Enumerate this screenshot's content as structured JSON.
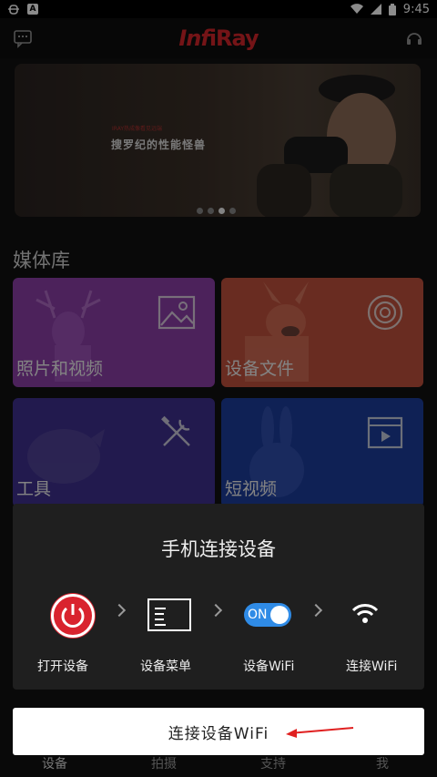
{
  "status_bar": {
    "time": "9:45"
  },
  "header": {
    "logo_prefix": "Inf",
    "logo_suffix": "iRay"
  },
  "banner": {
    "tagline": "IRAY热成像看见远端",
    "title": "搜罗纪的性能怪兽",
    "slide_count": 4,
    "active_slide": 3
  },
  "media_library": {
    "title": "媒体库",
    "tiles": [
      {
        "label": "照片和视频",
        "icon": "image-icon",
        "color": "#8a3ea7"
      },
      {
        "label": "设备文件",
        "icon": "target-icon",
        "color": "#c0503d"
      },
      {
        "label": "工具",
        "icon": "tools-icon",
        "color": "#3f318f"
      },
      {
        "label": "短视频",
        "icon": "video-icon",
        "color": "#1d3c9b"
      }
    ]
  },
  "dialog": {
    "title": "手机连接设备",
    "steps": [
      {
        "label": "打开设备",
        "icon": "power-icon"
      },
      {
        "label": "设备菜单",
        "icon": "menu-icon"
      },
      {
        "label": "设备WiFi",
        "icon": "toggle-icon",
        "toggle_text": "ON"
      },
      {
        "label": "连接WiFi",
        "icon": "wifi-icon"
      }
    ]
  },
  "connect_button": {
    "label": "连接设备WiFi"
  },
  "bottom_nav": [
    {
      "label": "设备"
    },
    {
      "label": "拍摄"
    },
    {
      "label": "支持"
    },
    {
      "label": "我"
    }
  ],
  "colors": {
    "accent_red": "#d9232e",
    "toggle_blue": "#2f8be6"
  }
}
